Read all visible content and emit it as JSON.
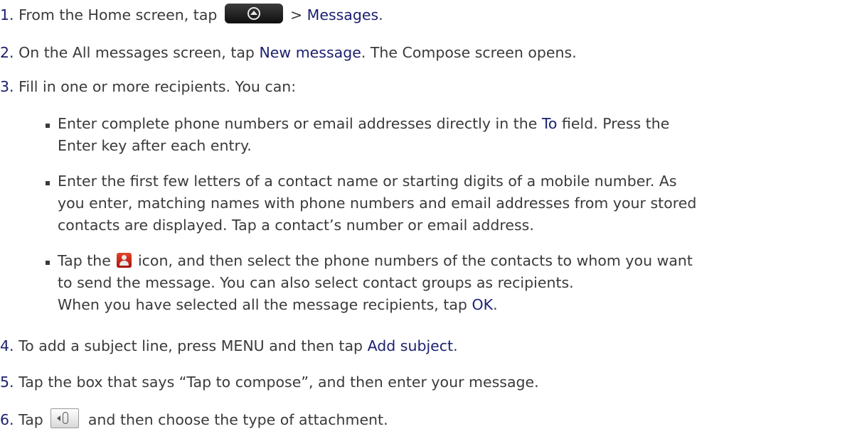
{
  "steps": {
    "s1": {
      "num": "1.",
      "pre": "From the Home screen, tap",
      "post": "> ",
      "ui": "Messages",
      "end": "."
    },
    "s2": {
      "num": "2.",
      "pre": "On the All messages screen, tap ",
      "ui": "New message",
      "post": ". The Compose screen opens."
    },
    "s3": {
      "num": "3.",
      "text": "Fill in one or more recipients. You can:"
    },
    "s4": {
      "num": "4.",
      "pre": "To add a subject line, press MENU and then tap ",
      "ui": "Add subject",
      "end": "."
    },
    "s5": {
      "num": "5.",
      "text": "Tap the box that says “Tap to compose”, and then enter your message."
    },
    "s6": {
      "num": "6.",
      "pre": "Tap",
      "post": "and then choose the type of attachment."
    }
  },
  "bullets": {
    "b1": {
      "l1_pre": "Enter complete phone numbers or email addresses directly in the ",
      "l1_ui": "To",
      "l1_post": " field. Press the",
      "l2": "Enter key after each entry."
    },
    "b2": {
      "l1": "Enter the first few letters of a contact name or starting digits of a mobile number. As",
      "l2": "you enter, matching names with phone numbers and email addresses from your stored",
      "l3": "contacts are displayed. Tap a contact’s number or email address."
    },
    "b3": {
      "l1_pre": "Tap the",
      "l1_post": "icon, and then select the phone numbers of the contacts to whom you want",
      "l2": "to send the message. You can also select contact groups as recipients.",
      "l3_pre": "When you have selected all the message recipients, tap ",
      "l3_ui": "OK",
      "l3_end": "."
    }
  },
  "icons": {
    "home": "all-apps-icon",
    "contact": "contact-icon",
    "attach": "attach-icon"
  },
  "colors": {
    "text": "#3a3a3a",
    "emphasis": "#1b1f6e",
    "contact_icon": "#d0301c"
  }
}
